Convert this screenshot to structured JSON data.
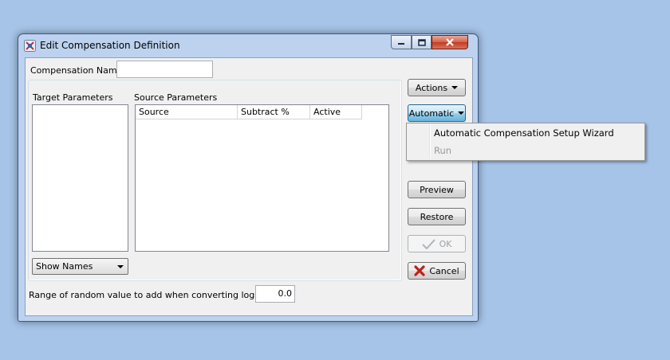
{
  "window": {
    "title": "Edit Compensation Definition",
    "controls": {
      "minimize": "minimize",
      "maximize": "maximize",
      "close": "close"
    }
  },
  "form": {
    "compensation_name_label": "Compensation Name",
    "compensation_name_value": "",
    "target_parameters_label": "Target Parameters",
    "source_parameters_label": "Source Parameters",
    "source_columns": [
      "Source",
      "Subtract %",
      "Active"
    ],
    "show_names_value": "Show Names",
    "random_range_label": "Range of random value to add when converting log data",
    "random_range_value": "0.0"
  },
  "buttons": {
    "actions": "Actions",
    "automatic": "Automatic",
    "preview": "Preview",
    "restore": "Restore",
    "ok": "OK",
    "cancel": "Cancel"
  },
  "menu": {
    "items": [
      {
        "label": "Automatic Compensation Setup Wizard",
        "enabled": true
      },
      {
        "label": "Run",
        "enabled": false
      }
    ]
  },
  "colors": {
    "desktop": "#a6c3e8",
    "window_frame": "#bcd2ee",
    "close_button": "#c23a22",
    "cancel_icon": "#c0201b",
    "disabled_text": "#a0a0a0"
  },
  "icons": {
    "app": "app-icon",
    "ok": "checkmark-icon",
    "cancel": "red-x-icon"
  }
}
